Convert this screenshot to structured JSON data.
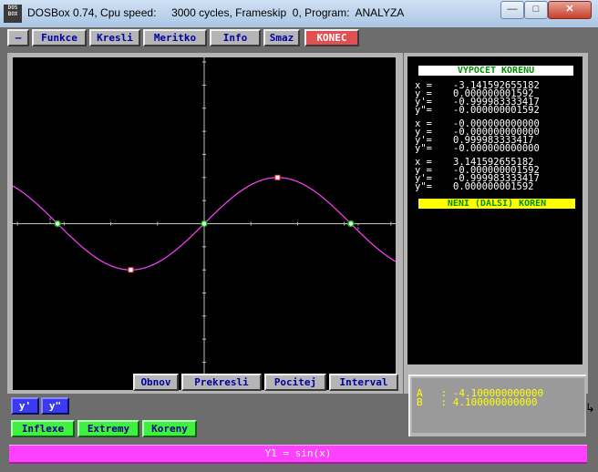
{
  "window": {
    "icon_text": "DOS\nBOX",
    "title": "DOSBox 0.74, Cpu speed:     3000 cycles, Frameskip  0, Program:  ANALYZA",
    "min_label": "—",
    "max_label": "□",
    "close_label": "✕"
  },
  "menu": {
    "items": [
      "–",
      "Funkce",
      "Kresli",
      "Meritko",
      "Info",
      "Smaz",
      "KONEC"
    ]
  },
  "graph": {
    "function": "sin(x)",
    "x_range": [
      -4.1,
      4.1
    ],
    "y_range": [
      -3.6,
      3.6
    ],
    "curve_color": "#ff40ff",
    "axis_color": "#c0c0c0",
    "roots": [
      -3.141592655182,
      0,
      3.141592655182
    ],
    "extrema": [
      {
        "x": -1.5708,
        "y": -1
      },
      {
        "x": 1.5708,
        "y": 1
      }
    ],
    "dashed_x": [
      -3.3,
      3.3
    ]
  },
  "results": {
    "title": "VYPOCET KORENU",
    "roots": [
      {
        "x": "-3.141592655182",
        "y": "0.000000001592",
        "y1": "-0.999983333417",
        "y2": "-0.000000001592"
      },
      {
        "x": "-0.000000000000",
        "y": "-0.000000000000",
        "y1": "0.999983333417",
        "y2": "-0.000000000000"
      },
      {
        "x": "3.141592655182",
        "y": "-0.000000001592",
        "y1": "-0.999983333417",
        "y2": "0.000000001592"
      }
    ],
    "labels": {
      "x": "x =",
      "y": "y =",
      "y1": "y'=",
      "y2": "y\"="
    },
    "status": "NENI (DALSI) KOREN"
  },
  "buttons": {
    "obnov": "Obnov",
    "prekresli": "Prekresli",
    "pocitej": "Pocitej",
    "interval": "Interval",
    "y1": "y'",
    "y2": "y\"",
    "inflexe": "Inflexe",
    "extremy": "Extremy",
    "koreny": "Koreny"
  },
  "interval": {
    "a_label": "A   :",
    "a_value": "-4.100000000000",
    "b_label": "B   :",
    "b_value": "4.100000000000"
  },
  "status_bar": "Y1 = sin(x)"
}
